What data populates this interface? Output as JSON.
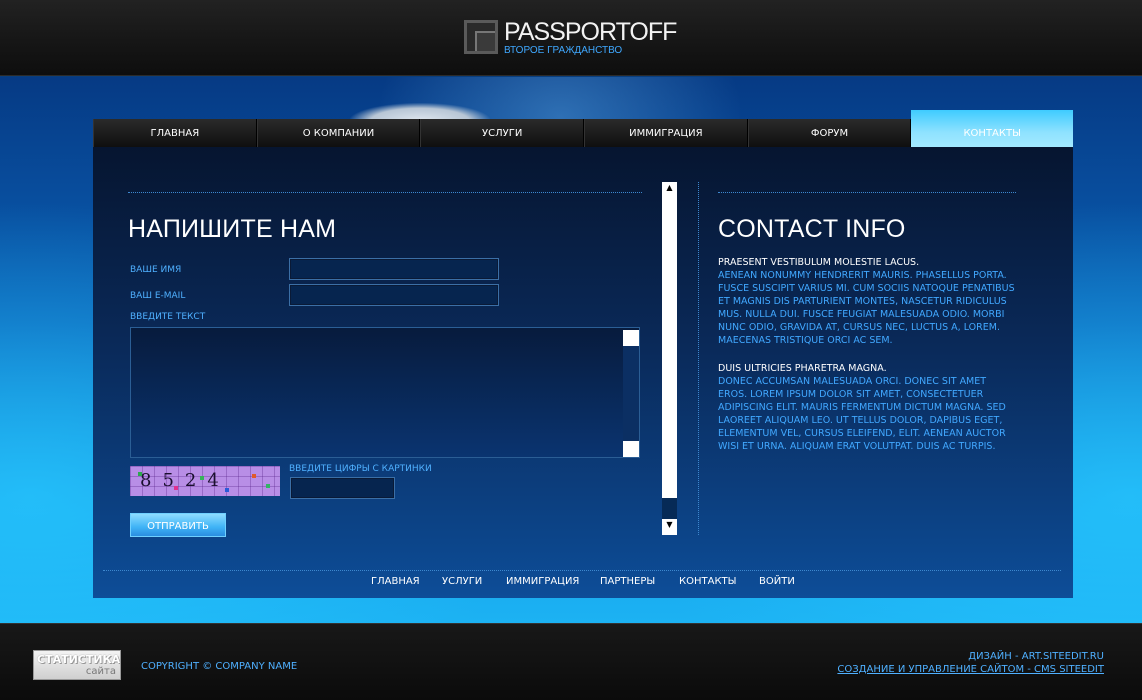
{
  "header": {
    "logo_title": "PASSPORTOFF",
    "logo_subtitle": "ВТОРОЕ ГРАЖДАНСТВО"
  },
  "nav": {
    "items": [
      {
        "label": "ГЛАВНАЯ"
      },
      {
        "label": "О КОМПАНИИ"
      },
      {
        "label": "УСЛУГИ"
      },
      {
        "label": "ИММИГРАЦИЯ"
      },
      {
        "label": "ФОРУМ"
      },
      {
        "label": "КОНТАКТЫ",
        "active": true
      }
    ]
  },
  "form": {
    "title": "НАПИШИТЕ НАМ",
    "name_label": "ВАШЕ ИМЯ",
    "email_label": "ВАШ E-MAIL",
    "text_label": "ВВЕДИТЕ ТЕКСТ",
    "captcha_label": "ВВЕДИТЕ ЦИФРЫ С КАРТИНКИ",
    "captcha_text": "8524",
    "submit_label": "ОТПРАВИТЬ",
    "name_value": "",
    "email_value": "",
    "text_value": "",
    "captcha_value": ""
  },
  "contact": {
    "title": "CONTACT INFO",
    "block1_title": "PRAESENT VESTIBULUM MOLESTIE LACUS.",
    "block1_body": "AENEAN NONUMMY HENDRERIT MAURIS. PHASELLUS PORTA. FUSCE SUSCIPIT VARIUS MI. CUM SOCIIS NATOQUE PENATIBUS ET MAGNIS DIS PARTURIENT MONTES, NASCETUR RIDICULUS MUS. NULLA DUI. FUSCE FEUGIAT MALESUADA ODIO. MORBI NUNC ODIO, GRAVIDA AT, CURSUS NEC, LUCTUS A, LOREM. MAECENAS TRISTIQUE ORCI AC SEM.",
    "block2_title": "DUIS ULTRICIES PHARETRA MAGNA.",
    "block2_body": "DONEC ACCUMSAN MALESUADA ORCI. DONEC SIT AMET EROS. LOREM IPSUM DOLOR SIT AMET, CONSECTETUER ADIPISCING ELIT. MAURIS FERMENTUM DICTUM MAGNA. SED LAOREET ALIQUAM LEO. UT TELLUS DOLOR, DAPIBUS EGET, ELEMENTUM VEL, CURSUS ELEIFEND, ELIT. AENEAN AUCTOR WISI ET URNA. ALIQUAM ERAT VOLUTPAT. DUIS AC TURPIS."
  },
  "bottom_nav": {
    "items": [
      "ГЛАВНАЯ",
      "УСЛУГИ",
      "ИММИГРАЦИЯ",
      "ПАРТНЕРЫ",
      "КОНТАКТЫ",
      "ВОЙТИ"
    ]
  },
  "footer": {
    "stat_title": "СТАТИСТИКА",
    "stat_sub": "сайта",
    "copyright": "COPYRIGHT © COMPANY NAME",
    "design": "ДИЗАЙН - ART.SITEEDIT.RU",
    "cms": "СОЗДАНИЕ И УПРАВЛЕНИЕ САЙТОМ - CMS SITEEDIT"
  },
  "colors": {
    "accent": "#41a8ff",
    "active_tab": "#6fd6ff",
    "panel": "#0a2a5a",
    "header": "#151515"
  },
  "icons": {
    "scroll_up": "▲",
    "scroll_down": "▼"
  }
}
